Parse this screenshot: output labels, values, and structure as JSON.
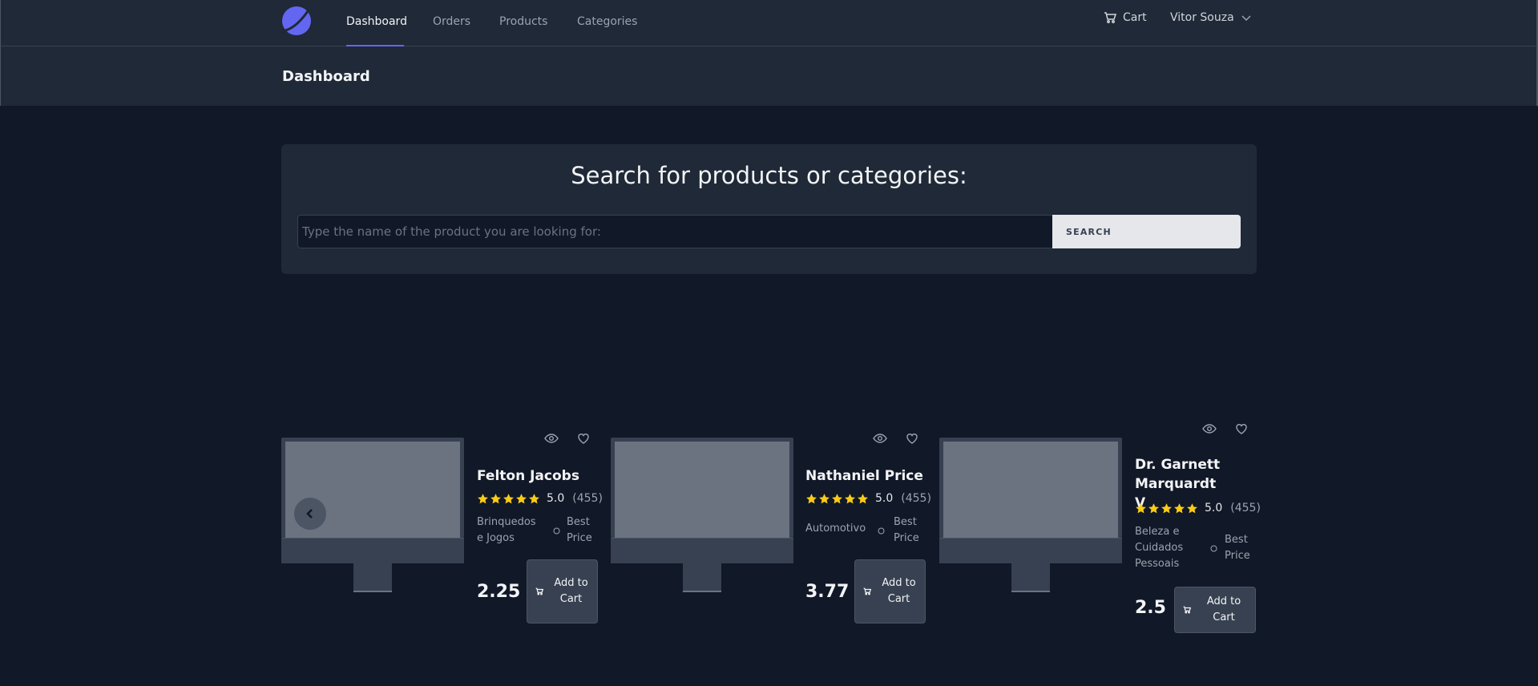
{
  "nav": {
    "links": [
      {
        "label": "Dashboard",
        "active": true
      },
      {
        "label": "Orders",
        "active": false
      },
      {
        "label": "Products",
        "active": false
      },
      {
        "label": "Categories",
        "active": false
      }
    ],
    "cart_label": "Cart",
    "user_name": "Vitor Souza"
  },
  "header": {
    "title": "Dashboard"
  },
  "search": {
    "title": "Search for products or categories:",
    "placeholder": "Type the name of the product you are looking for:",
    "button_label": "SEARCH"
  },
  "products": [
    {
      "name": "Felton Jacobs",
      "rating": "5.0",
      "reviews": "(455)",
      "category": "Brinquedos e Jogos",
      "tag": "Best Price",
      "price": "2.25",
      "cart_label": "Add to Cart"
    },
    {
      "name": "Nathaniel Price",
      "rating": "5.0",
      "reviews": "(455)",
      "category": "Automotivo",
      "tag": "Best Price",
      "price": "3.77",
      "cart_label": "Add to Cart"
    },
    {
      "name": "Dr. Garnett Marquardt V",
      "rating": "5.0",
      "reviews": "(455)",
      "category": "Beleza e Cuidados Pessoais",
      "tag": "Best Price",
      "price": "2.5",
      "cart_label": "Add to Cart"
    }
  ],
  "colors": {
    "accent": "#6366f1",
    "star": "#facc15",
    "background": "#111827",
    "surface": "#1f2937"
  }
}
